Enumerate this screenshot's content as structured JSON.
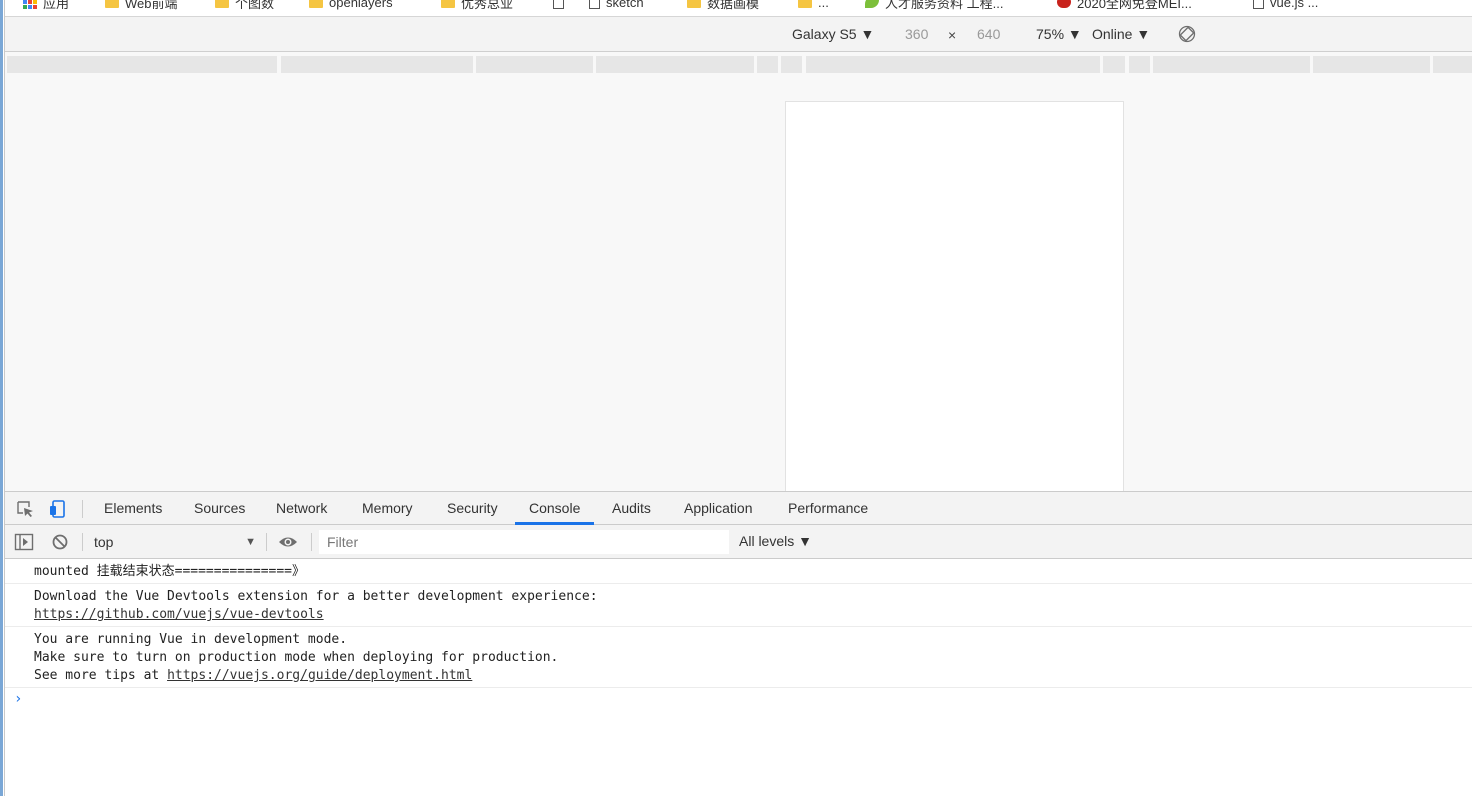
{
  "bookmarks": [
    {
      "label": "应用",
      "icon": "apps-icon"
    },
    {
      "label": "Web前端",
      "icon": "folder-icon"
    },
    {
      "label": "个图数",
      "icon": "folder-icon"
    },
    {
      "label": "openlayers",
      "icon": "folder-icon"
    },
    {
      "label": "优秀总业",
      "icon": "folder-icon"
    },
    {
      "label": "",
      "icon": "page-icon"
    },
    {
      "label": "sketch",
      "icon": "image-icon"
    },
    {
      "label": "数据画模",
      "icon": "folder-icon"
    },
    {
      "label": "...",
      "icon": "folder-icon"
    },
    {
      "label": "人才服务资料 工程...",
      "icon": "leaf-icon"
    },
    {
      "label": "2020全网免登MEI...",
      "icon": "red-icon"
    },
    {
      "label": "vue.js ...",
      "icon": "page-icon"
    }
  ],
  "device_toolbar": {
    "device": "Galaxy S5 ▼",
    "width": "360",
    "times": "×",
    "height": "640",
    "zoom": "75% ▼",
    "network": "Online ▼"
  },
  "devtools": {
    "tabs": [
      "Elements",
      "Sources",
      "Network",
      "Memory",
      "Security",
      "Console",
      "Audits",
      "Application",
      "Performance"
    ],
    "active_tab": "Console"
  },
  "console_toolbar": {
    "context": "top",
    "filter_placeholder": "Filter",
    "levels": "All levels ▼"
  },
  "console": {
    "messages": [
      {
        "lines": [
          "mounted 挂载结束状态===============》"
        ]
      },
      {
        "lines": [
          "Download the Vue Devtools extension for a better development experience:"
        ],
        "link": "https://github.com/vuejs/vue-devtools"
      },
      {
        "lines": [
          "You are running Vue in development mode.",
          "Make sure to turn on production mode when deploying for production."
        ],
        "prefix": "See more tips at ",
        "link": "https://vuejs.org/guide/deployment.html"
      }
    ],
    "prompt": "›"
  },
  "colors": {
    "accent": "#1a73e8",
    "panel_bg": "#f3f3f3",
    "viewport_bg": "#f8f8f8"
  }
}
